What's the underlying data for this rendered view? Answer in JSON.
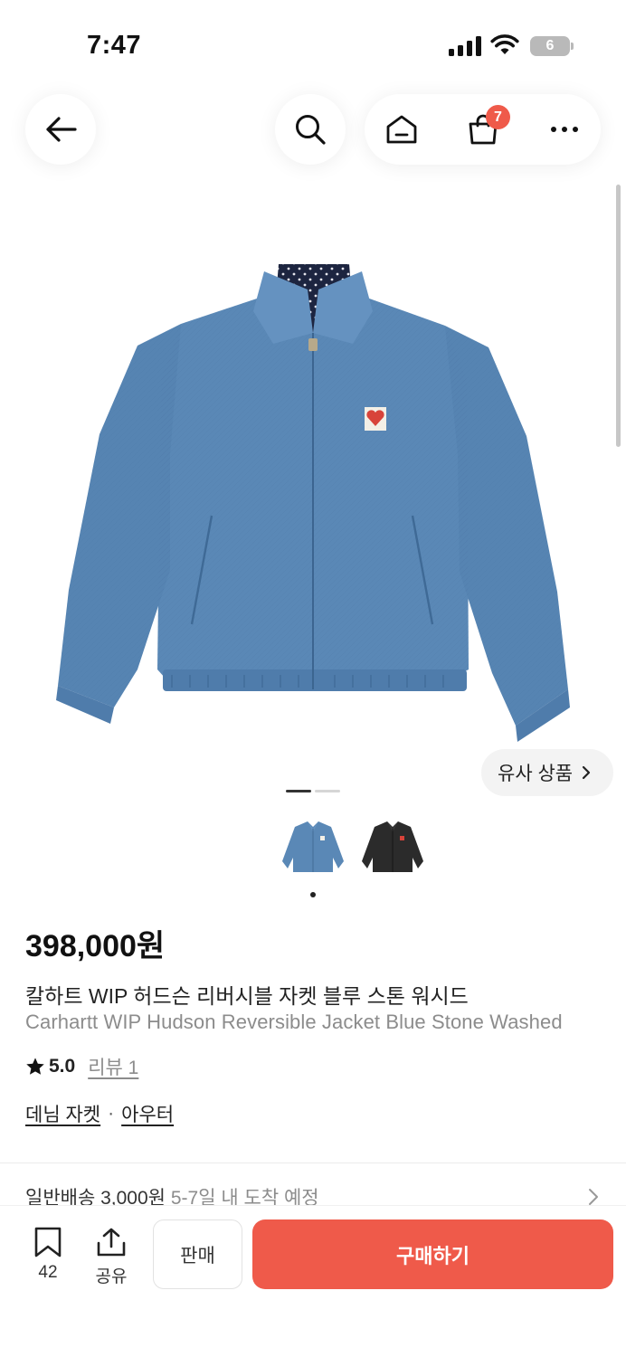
{
  "status_bar": {
    "time": "7:47",
    "battery": "6"
  },
  "nav": {
    "cart_count": "7"
  },
  "product": {
    "similar_label": "유사 상품",
    "price": "398,000원",
    "title_ko": "칼하트 WIP 허드슨 리버시블 자켓 블루 스톤 워시드",
    "title_en": "Carhartt WIP Hudson Reversible Jacket Blue Stone Washed",
    "rating": "5.0",
    "review_label": "리뷰 1",
    "category_main": "데님 자켓",
    "category_separator": "·",
    "category_sub": "아우터",
    "gallery": {
      "image_count": 2,
      "current_index": 1
    }
  },
  "shipping": {
    "label": "일반배송 3,000원",
    "eta": "5-7일 내 도착 예정"
  },
  "bottom": {
    "bookmark_count": "42",
    "share_label": "공유",
    "sell_label": "판매",
    "buy_label": "구매하기"
  },
  "icons": [
    "back-arrow-icon",
    "search-icon",
    "home-icon",
    "shopping-bag-icon",
    "more-icon",
    "star-icon",
    "bookmark-icon",
    "share-icon",
    "chevron-right-icon"
  ],
  "colors": {
    "accent": "#ef5a4a",
    "denim": "#5a88b6",
    "text": "#222222",
    "muted": "#8c8c8c"
  }
}
